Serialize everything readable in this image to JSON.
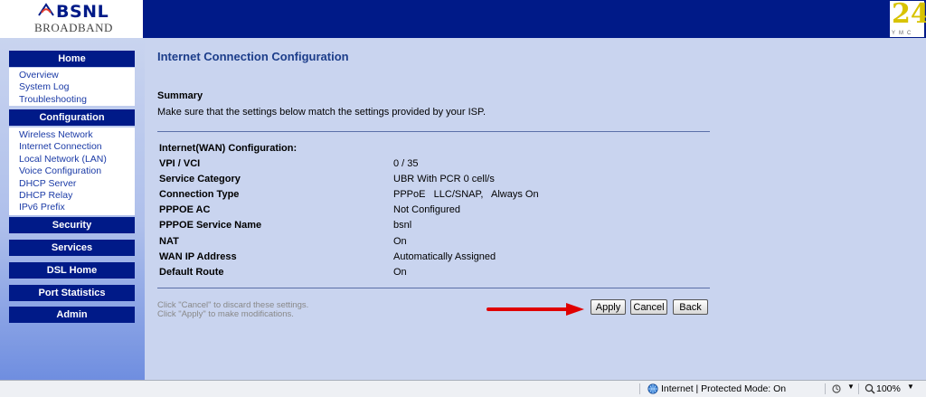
{
  "header": {
    "brand_name": "BSNL",
    "brand_sub": "BROADBAND",
    "right_logo_text": "24",
    "right_logo_sub": "YMC"
  },
  "sidebar": {
    "sections": [
      {
        "label": "Home",
        "items": [
          "Overview",
          "System Log",
          "Troubleshooting"
        ]
      },
      {
        "label": "Configuration",
        "items": [
          "Wireless Network",
          "Internet Connection",
          "Local Network (LAN)",
          "Voice Configuration",
          "DHCP Server",
          "DHCP Relay",
          "IPv6 Prefix"
        ]
      },
      {
        "label": "Security"
      },
      {
        "label": "Services"
      },
      {
        "label": "DSL Home"
      },
      {
        "label": "Port Statistics"
      },
      {
        "label": "Admin"
      }
    ]
  },
  "main": {
    "title": "Internet Connection Configuration",
    "summary_title": "Summary",
    "summary_desc": "Make sure that the settings below match the settings provided by your ISP.",
    "section_label": "Internet(WAN) Configuration:",
    "rows": [
      {
        "label": "VPI / VCI",
        "value": "0 / 35"
      },
      {
        "label": "Service Category",
        "value": "UBR With PCR 0 cell/s"
      },
      {
        "label": "Connection Type",
        "value": "PPPoE   LLC/SNAP,   Always On"
      },
      {
        "label": "PPPOE AC",
        "value": "Not Configured"
      },
      {
        "label": "PPPOE Service Name",
        "value": "bsnl"
      },
      {
        "label": "NAT",
        "value": "On"
      },
      {
        "label": "WAN IP Address",
        "value": "Automatically Assigned"
      },
      {
        "label": "Default Route",
        "value": "On"
      }
    ],
    "hint_cancel": "Click \"Cancel\" to discard these settings.",
    "hint_apply": "Click \"Apply\" to make modifications.",
    "buttons": {
      "apply": "Apply",
      "cancel": "Cancel",
      "back": "Back"
    }
  },
  "statusbar": {
    "zone": "Internet | Protected Mode: On",
    "zoom": "100%"
  },
  "colors": {
    "header": "#001a88",
    "background": "#c9d4ef",
    "link": "#1a3aa6",
    "arrow": "#e00000"
  }
}
